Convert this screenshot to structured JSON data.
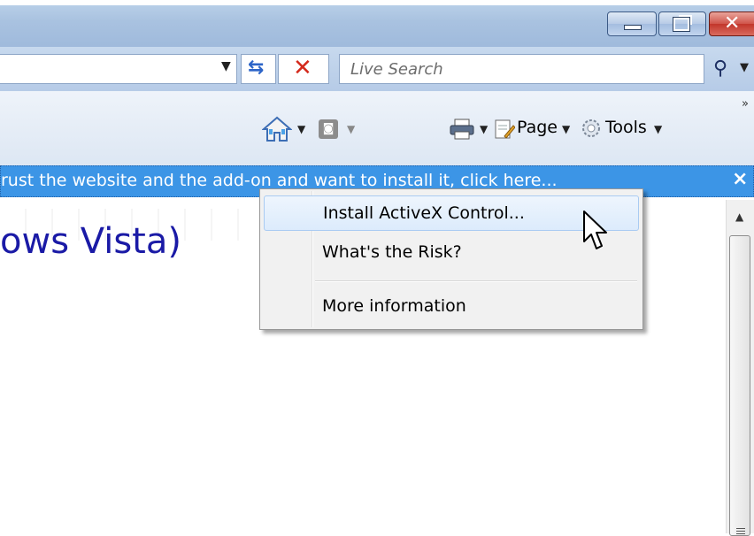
{
  "window": {
    "buttons": {
      "minimize": "minimize",
      "maximize": "maximize",
      "close": "close"
    }
  },
  "addressbar": {
    "url": "",
    "search_placeholder": "Live Search"
  },
  "commandbar": {
    "page_label": "Page",
    "tools_label": "Tools",
    "overflow": "»"
  },
  "infobar": {
    "text": "rust the website and the add-on and want to install it, click here...",
    "close": "×"
  },
  "page": {
    "heading": "ows Vista)"
  },
  "context_menu": {
    "items": [
      {
        "label": "Install ActiveX Control..."
      },
      {
        "label": "What's the Risk?"
      },
      {
        "label": "More information"
      }
    ]
  },
  "colors": {
    "infobar": "#3c95e6",
    "heading": "#1a1aa6",
    "close_button": "#c2362b"
  }
}
